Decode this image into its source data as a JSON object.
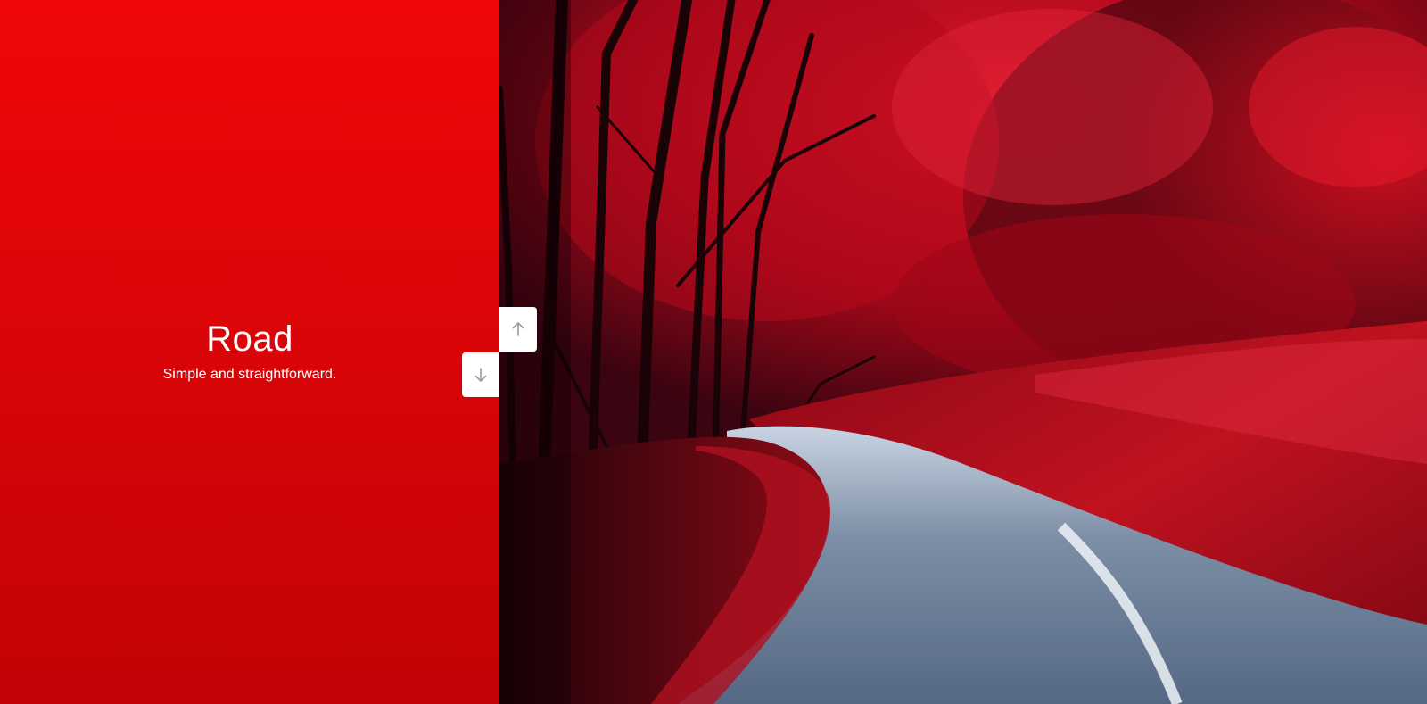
{
  "slide": {
    "title": "Road",
    "description": "Simple and straightforward."
  },
  "navigation": {
    "up_icon": "arrow-up-icon",
    "down_icon": "arrow-down-icon"
  },
  "colors": {
    "panel_accent": "#e00508",
    "button_background": "#ffffff",
    "arrow_color": "#9a9a9a"
  }
}
